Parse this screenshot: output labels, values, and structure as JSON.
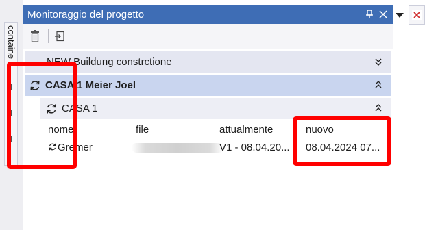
{
  "side_tab": {
    "label": "containe"
  },
  "tool_window": {
    "title": "Monitoraggio del progetto"
  },
  "groups": [
    {
      "label": "NEW Buildung constrctione",
      "expanded": false
    },
    {
      "label": "CASA 1 Meier  Joel",
      "expanded": true
    },
    {
      "label": "CASA 1",
      "expanded": true
    }
  ],
  "table": {
    "columns": [
      "nome",
      "file",
      "attualmente",
      "nuovo"
    ],
    "rows": [
      {
        "name": "Gremer",
        "file": "",
        "current": "V1 - 08.04.20...",
        "new": "08.04.2024 07..."
      }
    ]
  },
  "icons": {
    "pin": "pin-icon",
    "close": "close-icon",
    "trash": "trash-icon",
    "export": "export-icon",
    "sync": "sync-icon",
    "chevron_down": "double-chevron-down-icon",
    "chevron_up": "double-chevron-up-icon",
    "menu": "dropdown-arrow-icon"
  },
  "colors": {
    "title_bar": "#3e6db5",
    "group_collapsed": "#e4e6f1",
    "group_selected": "#c9d5ef",
    "group_sub": "#edeef5",
    "highlight": "#ff0000"
  }
}
